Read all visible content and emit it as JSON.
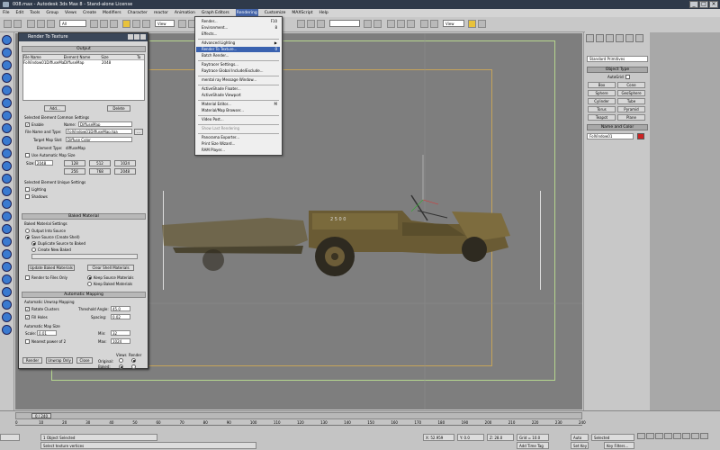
{
  "window": {
    "title": "008.max - Autodesk 3ds Max 8 - Stand-alone License"
  },
  "menubar": [
    "File",
    "Edit",
    "Tools",
    "Group",
    "Views",
    "Create",
    "Modifiers",
    "Character",
    "reactor",
    "Animation",
    "Graph Editors",
    "Rendering",
    "Customize",
    "MAXScript",
    "Help"
  ],
  "toolbar": {
    "selection_filter": "All",
    "ref_coord": "View"
  },
  "viewport": {
    "label": "Perspective"
  },
  "rendering_menu": {
    "items": [
      {
        "label": "Render...",
        "shortcut": "F10"
      },
      {
        "label": "Environment...",
        "shortcut": "8"
      },
      {
        "label": "Effects...",
        "shortcut": ""
      },
      {
        "label": "Advanced Lighting",
        "shortcut": "▶"
      },
      {
        "label": "Render To Texture...",
        "shortcut": "0"
      },
      {
        "label": "Batch Render...",
        "shortcut": ""
      },
      {
        "label": "Raytracer Settings...",
        "shortcut": ""
      },
      {
        "label": "Raytrace Global Include/Exclude...",
        "shortcut": ""
      },
      {
        "label": "mental ray Message Window...",
        "shortcut": ""
      },
      {
        "label": "ActiveShade Floater...",
        "shortcut": ""
      },
      {
        "label": "ActiveShade Viewport",
        "shortcut": ""
      },
      {
        "label": "Material Editor...",
        "shortcut": "M"
      },
      {
        "label": "Material/Map Browser...",
        "shortcut": ""
      },
      {
        "label": "Video Post...",
        "shortcut": ""
      },
      {
        "label": "Show Last Rendering",
        "shortcut": ""
      },
      {
        "label": "Panorama Exporter...",
        "shortcut": ""
      },
      {
        "label": "Print Size Wizard...",
        "shortcut": ""
      },
      {
        "label": "RAM Player...",
        "shortcut": ""
      }
    ]
  },
  "dialog": {
    "title": "Render To Texture",
    "output_header": "Output",
    "table_cols": [
      "File Name",
      "Element Name",
      "Size",
      "Ta"
    ],
    "table_row": [
      "FolVindow01DiffuseMap",
      "DiffuseMap",
      "2048",
      ""
    ],
    "add": "Add...",
    "delete": "Delete",
    "sel_elem_header": "Selected Element Common Settings",
    "enable": "Enable",
    "name_lbl": "Name:",
    "name_val": "DiffuseMap",
    "file_lbl": "File Name and Type:",
    "file_val": "FolVindow01DiffuseMap.tga",
    "target_lbl": "Target Map Slot:",
    "target_val": "Diffuse Color",
    "elemtype_lbl": "Element Type:",
    "elemtype_val": "diffuseMap",
    "auto_size": "Use Automatic Map Size",
    "size_lbl": "Size:",
    "size_val": "2048",
    "sizes": [
      "128",
      "512",
      "1024",
      "256",
      "768",
      "2048"
    ],
    "unique_header": "Selected Element Unique Settings",
    "lighting": "Lighting",
    "shadows": "Shadows",
    "baked_header": "Baked Material",
    "baked_settings": "Baked Material Settings",
    "output_into": "Output Into Source",
    "save_source": "Save Source (Create Shell)",
    "dup_source": "Duplicate Source to Baked",
    "create_new": "Create New Baked",
    "update_baked": "Update Baked Materials",
    "clear_shell": "Clear Shell Materials",
    "render_files": "Render to Files Only",
    "keep_source": "Keep Source Materials",
    "keep_baked": "Keep Baked Materials",
    "auto_map_header": "Automatic Mapping",
    "unwrap": "Automatic Unwrap Mapping",
    "rotate": "Rotate Clusters",
    "threshold_lbl": "Threshold Angle:",
    "threshold_val": "45.0",
    "fill": "Fill Holes",
    "spacing_lbl": "Spacing:",
    "spacing_val": "0.02",
    "mapsize": "Automatic Map Size",
    "scale_lbl": "Scale:",
    "scale_val": "0.01",
    "min_lbl": "Min:",
    "min_val": "32",
    "nearest": "Nearest power of 2",
    "max_lbl": "Max:",
    "max_val": "1024",
    "render": "Render",
    "unwrap_only": "Unwrap Only",
    "close": "Close",
    "views_lbl": "Views",
    "render_lbl": "Render",
    "original": "Original:",
    "baked": "Baked:"
  },
  "command_panel": {
    "primitives": "Standard Primitives",
    "object_type": "Object Type",
    "autogrid": "AutoGrid",
    "buttons": [
      "Box",
      "Cone",
      "Sphere",
      "GeoSphere",
      "Cylinder",
      "Tube",
      "Torus",
      "Pyramid",
      "Teapot",
      "Plane"
    ],
    "name_color": "Name and Color",
    "object_name": "FolVindow01",
    "object_color": "#cc2222"
  },
  "bottom": {
    "frame": "0 / 240",
    "ticks": [
      "0",
      "10",
      "20",
      "30",
      "40",
      "50",
      "60",
      "70",
      "80",
      "90",
      "100",
      "110",
      "120",
      "130",
      "140",
      "150",
      "160",
      "170",
      "180",
      "190",
      "200",
      "210",
      "220",
      "230",
      "240"
    ],
    "selected": "1 Object Selected",
    "prompt": "Select texture vertices",
    "x": "X: 52.959",
    "y": "Y: 0.0",
    "z": "Z: 28.0",
    "grid": "Grid = 10.0",
    "autokey": "Auto Key",
    "setkey": "Set Key",
    "sel_mode": "Selected",
    "key_filters": "Key Filters...",
    "add_time_tag": "Add Time Tag"
  }
}
